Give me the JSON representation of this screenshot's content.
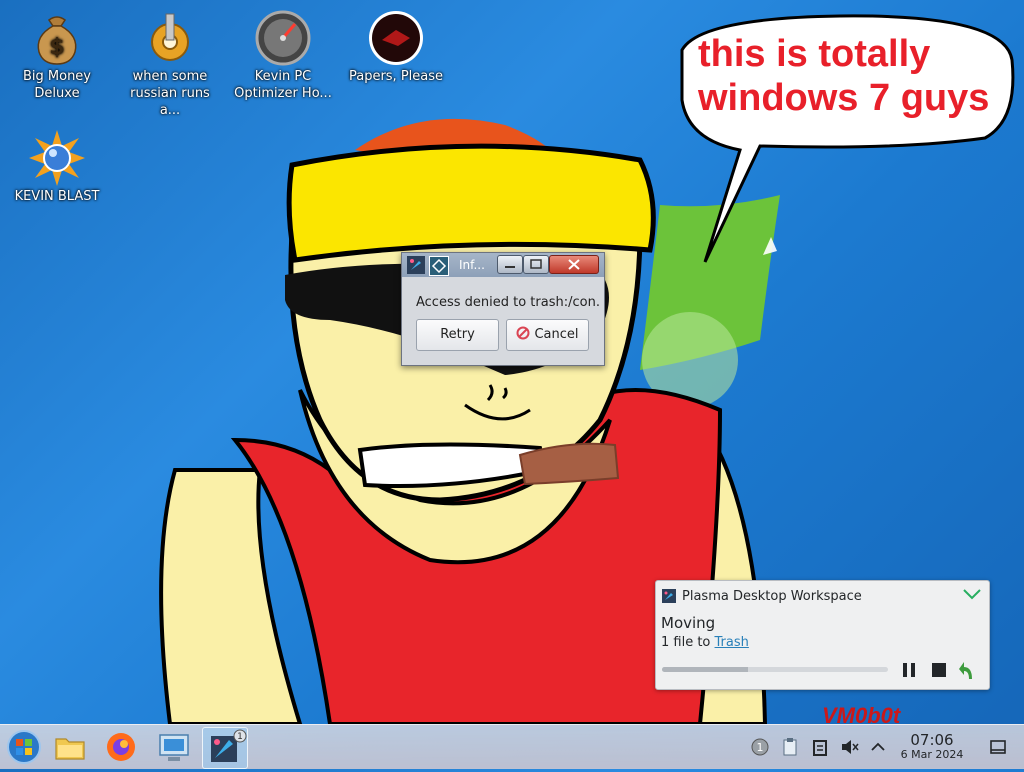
{
  "desktop": {
    "icons": [
      {
        "label": "Big Money\nDeluxe",
        "icon": "money-bag-icon"
      },
      {
        "label": "when some\nrussian runs a...",
        "icon": "gear-icon"
      },
      {
        "label": "Kevin PC\nOptimizer Ho...",
        "icon": "gauge-icon"
      },
      {
        "label": "Papers, Please",
        "icon": "papers-please-icon"
      },
      {
        "label": "KEVIN BLAST",
        "icon": "blast-icon"
      }
    ],
    "bubble_text": "this is totally windows 7 guys",
    "watermark": "VM0b0t"
  },
  "dialog": {
    "title": "Inf...",
    "message": "Access denied to trash:/con.",
    "retry_label": "Retry",
    "cancel_label": "Cancel"
  },
  "notification": {
    "app_name": "Plasma Desktop Workspace",
    "title": "Moving",
    "body_prefix": "1 file to ",
    "body_link": "Trash",
    "progress": 0.38
  },
  "taskbar": {
    "items": [
      "start-orb-icon",
      "file-manager-icon",
      "firefox-icon",
      "system-settings-icon",
      "plasma-task-icon"
    ],
    "active_badge": "1",
    "tray_badge": "1",
    "time": "07:06",
    "date": "6 Mar 2024"
  },
  "colors": {
    "bubble_text": "#e8202a",
    "watermark": "#cc1818",
    "link": "#2980b9"
  }
}
